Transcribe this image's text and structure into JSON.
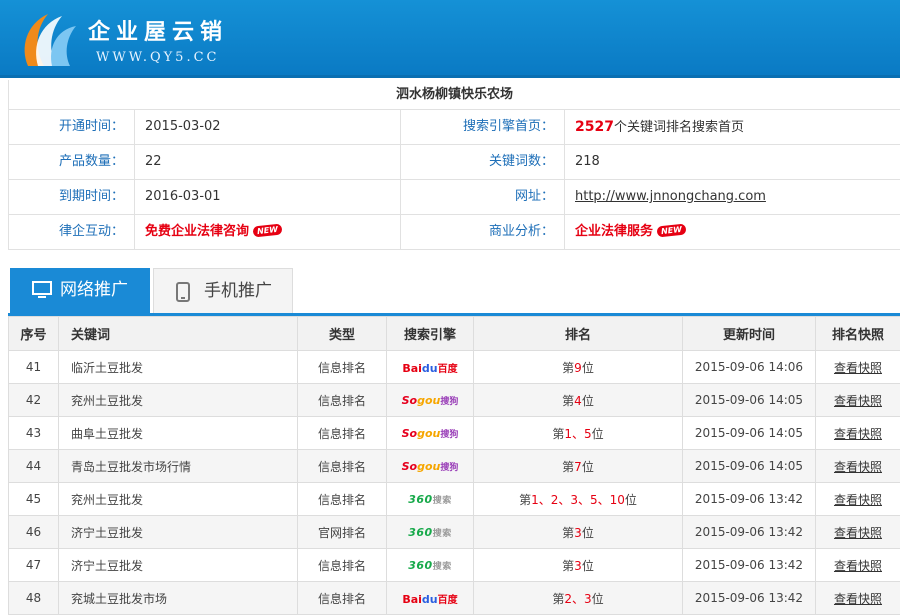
{
  "header": {
    "brand": "企业屋云销",
    "url": "WWW.QY5.CC"
  },
  "company": {
    "name": "泗水杨柳镇快乐农场",
    "rows": [
      {
        "label1": "开通时间：",
        "value1": "2015-03-02",
        "label2": "搜索引擎首页：",
        "value2_num": "2527",
        "value2_text": "个关键词排名搜索首页"
      },
      {
        "label1": "产品数量：",
        "value1": "22",
        "label2": "关键词数：",
        "value2_text": "218"
      },
      {
        "label1": "到期时间：",
        "value1": "2016-03-01",
        "label2": "网址：",
        "value2_text": "http://www.jnnongchang.com"
      },
      {
        "label1": "律企互动：",
        "value1": "免费企业法律咨询",
        "label2": "商业分析：",
        "value2_text": "企业法律服务"
      }
    ],
    "new_badge": "NEW"
  },
  "tabs": {
    "web": "网络推广",
    "mobile": "手机推广"
  },
  "table": {
    "headers": [
      "序号",
      "关键词",
      "类型",
      "搜索引擎",
      "排名",
      "更新时间",
      "排名快照"
    ],
    "rows": [
      {
        "no": "41",
        "kw": "临沂土豆批发",
        "type": "信息排名",
        "engine": "baidu",
        "rank": [
          "第",
          "9",
          "位"
        ],
        "time": "2015-09-06 14:06",
        "snap": "查看快照"
      },
      {
        "no": "42",
        "kw": "兖州土豆批发",
        "type": "信息排名",
        "engine": "sogou",
        "rank": [
          "第",
          "4",
          "位"
        ],
        "time": "2015-09-06 14:05",
        "snap": "查看快照"
      },
      {
        "no": "43",
        "kw": "曲阜土豆批发",
        "type": "信息排名",
        "engine": "sogou",
        "rank": [
          "第",
          "1、5",
          "位"
        ],
        "time": "2015-09-06 14:05",
        "snap": "查看快照"
      },
      {
        "no": "44",
        "kw": "青岛土豆批发市场行情",
        "type": "信息排名",
        "engine": "sogou",
        "rank": [
          "第",
          "7",
          "位"
        ],
        "time": "2015-09-06 14:05",
        "snap": "查看快照"
      },
      {
        "no": "45",
        "kw": "兖州土豆批发",
        "type": "信息排名",
        "engine": "360",
        "rank": [
          "第",
          "1、2、3、5、10",
          "位"
        ],
        "time": "2015-09-06 13:42",
        "snap": "查看快照"
      },
      {
        "no": "46",
        "kw": "济宁土豆批发",
        "type": "官网排名",
        "engine": "360",
        "rank": [
          "第",
          "3",
          "位"
        ],
        "time": "2015-09-06 13:42",
        "snap": "查看快照"
      },
      {
        "no": "47",
        "kw": "济宁土豆批发",
        "type": "信息排名",
        "engine": "360",
        "rank": [
          "第",
          "3",
          "位"
        ],
        "time": "2015-09-06 13:42",
        "snap": "查看快照"
      },
      {
        "no": "48",
        "kw": "兖城土豆批发市场",
        "type": "信息排名",
        "engine": "baidu",
        "rank": [
          "第",
          "2、3",
          "位"
        ],
        "time": "2015-09-06 13:42",
        "snap": "查看快照"
      }
    ]
  },
  "engines": {
    "baidu": {
      "a": "Bai",
      "b": "du",
      "c": "百度"
    },
    "sogou": {
      "a": "So",
      "b": "gou",
      "c": "搜狗"
    },
    "360": {
      "a": "360",
      "b": "搜索"
    }
  }
}
